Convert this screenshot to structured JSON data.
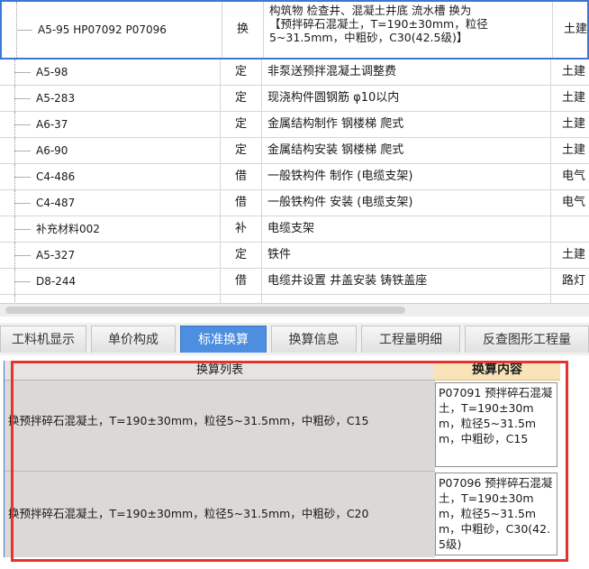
{
  "grid": {
    "selected_row": {
      "code": "A5-95 HP07092 P07096",
      "type": "换",
      "name_lines": [
        "构筑物 检查井、混凝土井底 流水槽  换为",
        "【预拌碎石混凝土，T=190±30mm，粒径",
        "5~31.5mm，中粗砂，C30(42.5级)】"
      ],
      "category": "土建"
    },
    "rows": [
      {
        "code": "A5-98",
        "type": "定",
        "name": "非泵送预拌混凝土调整费",
        "category": "土建"
      },
      {
        "code": "A5-283",
        "type": "定",
        "name": "现浇构件圆钢筋 φ10以内",
        "category": "土建"
      },
      {
        "code": "A6-37",
        "type": "定",
        "name": "金属结构制作 钢楼梯 爬式",
        "category": "土建"
      },
      {
        "code": "A6-90",
        "type": "定",
        "name": "金属结构安装 钢楼梯 爬式",
        "category": "土建"
      },
      {
        "code": "C4-486",
        "type": "借",
        "name": "一般铁构件 制作 (电缆支架)",
        "category": "电气"
      },
      {
        "code": "C4-487",
        "type": "借",
        "name": "一般铁构件 安装 (电缆支架)",
        "category": "电气"
      },
      {
        "code": "补充材料002",
        "type": "补",
        "name": "电缆支架",
        "category": ""
      },
      {
        "code": "A5-327",
        "type": "定",
        "name": "铁件",
        "category": "土建"
      },
      {
        "code": "D8-244",
        "type": "借",
        "name": "电缆井设置 井盖安装 铸铁盖座",
        "category": "路灯"
      }
    ]
  },
  "tabs": [
    {
      "label": "工料机显示",
      "active": false
    },
    {
      "label": "单价构成",
      "active": false
    },
    {
      "label": "标准换算",
      "active": true
    },
    {
      "label": "换算信息",
      "active": false
    },
    {
      "label": "工程量明细",
      "active": false
    },
    {
      "label": "反查图形工程量",
      "active": false
    }
  ],
  "conversion": {
    "list_header": "换算列表",
    "content_header": "换算内容",
    "items": [
      {
        "list_text": "换预拌碎石混凝土，T=190±30mm，粒径5~31.5mm，中粗砂，C15",
        "content_text": "P07091  预拌碎石混凝土，T=190±30mm，粒径5~31.5mm，中粗砂，C15"
      },
      {
        "list_text": "换预拌碎石混凝土，T=190±30mm，粒径5~31.5mm，中粗砂，C20",
        "content_text": "P07096  预拌碎石混凝土，T=190±30mm，粒径5~31.5mm，中粗砂，C30(42.5级)"
      }
    ]
  },
  "colors": {
    "accent": "#4d8ee0",
    "highlight_border": "#e8322d",
    "selection_border": "#3a78d6"
  }
}
